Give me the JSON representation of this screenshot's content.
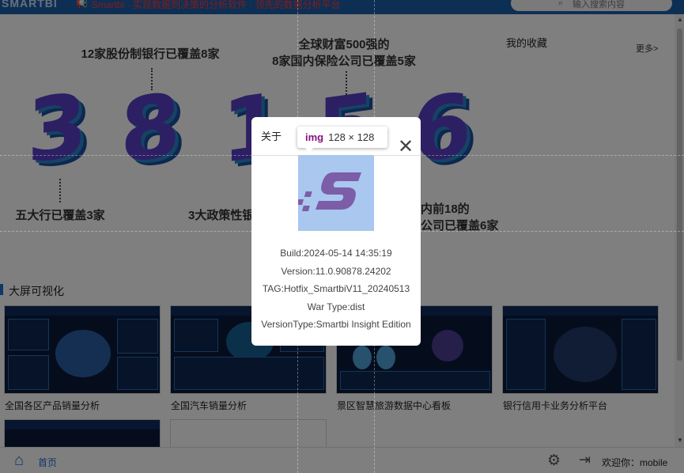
{
  "header": {
    "logo": "SMARTBI",
    "notice": "Smartbi · 实现数据到决策的分析软件 · 领先的数据分析平台",
    "search_placeholder": "输入搜索内容"
  },
  "banner": {
    "captions": {
      "top_left": "12家股份制银行已覆盖8家",
      "top_center_line1": "全球财富500强的",
      "top_center_line2": "8家国内保险公司已覆盖5家",
      "bottom_left": "五大行已覆盖3家",
      "bottom_center": "3大政策性银",
      "bottom_right_line1": "内前18的",
      "bottom_right_line2": "公司已覆盖6家"
    },
    "digits": [
      "3",
      "8",
      "1",
      "5",
      "6"
    ]
  },
  "favorites": {
    "title": "我的收藏",
    "more": "更多>"
  },
  "section": {
    "title": "大屏可视化"
  },
  "cards": [
    {
      "label": "全国各区产品销量分析"
    },
    {
      "label": "全国汽车销量分析"
    },
    {
      "label": "景区智慧旅游数据中心看板"
    },
    {
      "label": "银行信用卡业务分析平台"
    }
  ],
  "footer": {
    "home": "首页",
    "welcome": "欢迎你：mobile"
  },
  "dialog": {
    "title": "关于",
    "build": "Build:2024-05-14 14:35:19",
    "version": "Version:11.0.90878.24202",
    "tag": "TAG:Hotfix_SmartbiV11_20240513",
    "war_type": "War Type:dist",
    "version_type": "VersionType:Smartbi Insight Edition"
  },
  "tooltip": {
    "tag": "img",
    "dims": "128 × 128"
  },
  "colors": {
    "brand": "#1c5fa8",
    "accent": "#1c6fd0",
    "logo_bg": "#a9c7ef",
    "logo_mark": "#7b5ea7"
  }
}
